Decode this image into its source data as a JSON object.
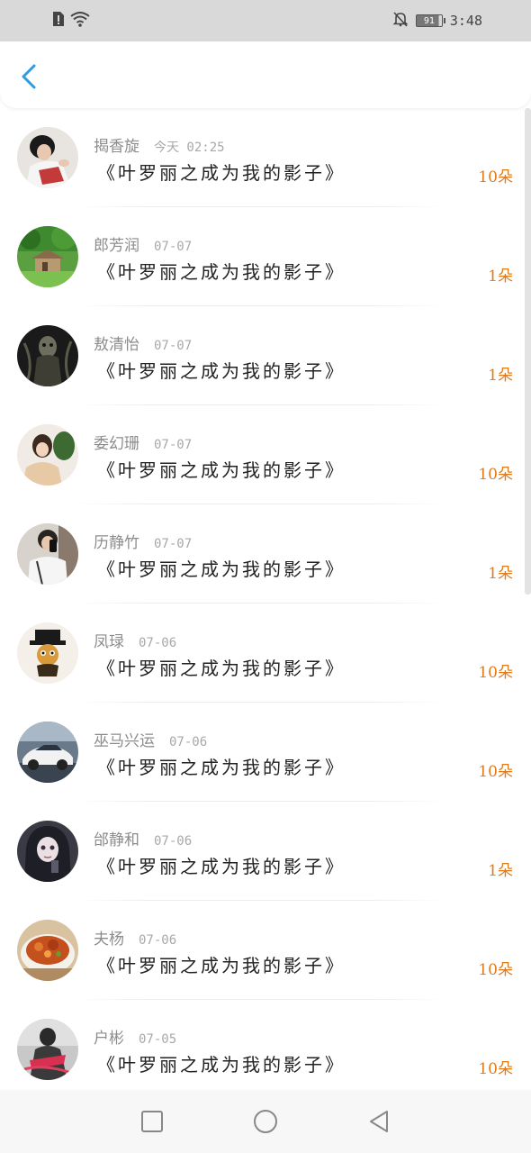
{
  "status_bar": {
    "time": "3:48",
    "battery_level": "91",
    "icons": [
      "sim-alert-icon",
      "wifi-icon",
      "notifications-off-icon",
      "battery-icon"
    ]
  },
  "header": {
    "back_icon": "chevron-left-icon",
    "accent_color": "#2b9be3"
  },
  "colors": {
    "count": "#e07a1a",
    "name": "#8c8c8c",
    "title": "#222222"
  },
  "items": [
    {
      "name": "揭香旋",
      "date": "今天 02:25",
      "title": "《叶罗丽之成为我的影子》",
      "count": "10朵"
    },
    {
      "name": "郎芳润",
      "date": "07-07",
      "title": "《叶罗丽之成为我的影子》",
      "count": "1朵"
    },
    {
      "name": "敖清怡",
      "date": "07-07",
      "title": "《叶罗丽之成为我的影子》",
      "count": "1朵"
    },
    {
      "name": "委幻珊",
      "date": "07-07",
      "title": "《叶罗丽之成为我的影子》",
      "count": "10朵"
    },
    {
      "name": "历静竹",
      "date": "07-07",
      "title": "《叶罗丽之成为我的影子》",
      "count": "1朵"
    },
    {
      "name": "凤琭",
      "date": "07-06",
      "title": "《叶罗丽之成为我的影子》",
      "count": "10朵"
    },
    {
      "name": "巫马兴运",
      "date": "07-06",
      "title": "《叶罗丽之成为我的影子》",
      "count": "10朵"
    },
    {
      "name": "邰静和",
      "date": "07-06",
      "title": "《叶罗丽之成为我的影子》",
      "count": "1朵"
    },
    {
      "name": "夫杨",
      "date": "07-06",
      "title": "《叶罗丽之成为我的影子》",
      "count": "10朵"
    },
    {
      "name": "户彬",
      "date": "07-05",
      "title": "《叶罗丽之成为我的影子》",
      "count": "10朵"
    }
  ],
  "nav_bar": {
    "icons": [
      "recent-apps-icon",
      "home-icon",
      "back-icon"
    ]
  }
}
